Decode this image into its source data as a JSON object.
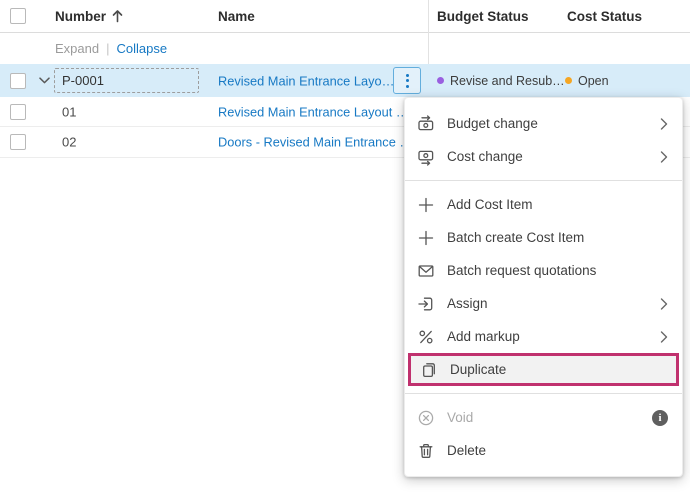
{
  "table": {
    "header": {
      "columns": {
        "number": "Number",
        "name": "Name",
        "budget_status": "Budget Status",
        "cost_status": "Cost Status"
      },
      "sort": {
        "column": "Number",
        "direction": "ascending"
      }
    },
    "toolbar": {
      "expand_label": "Expand",
      "separator": "|",
      "collapse_label": "Collapse"
    },
    "rows": [
      {
        "number": "P-0001",
        "name": "Revised Main Entrance Layo…",
        "budget_status": "Revise and Resub…",
        "cost_status": "Open",
        "selected": true,
        "expanded": true
      },
      {
        "number": "01",
        "name": "Revised Main Entrance Layout …"
      },
      {
        "number": "02",
        "name": "Doors - Revised Main Entrance …"
      }
    ]
  },
  "context_menu": {
    "groups": [
      {
        "items": [
          {
            "label": "Budget change",
            "icon": "budget-change-icon",
            "has_submenu": true
          },
          {
            "label": "Cost change",
            "icon": "cost-change-icon",
            "has_submenu": true
          }
        ]
      },
      {
        "items": [
          {
            "label": "Add Cost Item",
            "icon": "plus-icon"
          },
          {
            "label": "Batch create Cost Item",
            "icon": "plus-icon"
          },
          {
            "label": "Batch request quotations",
            "icon": "envelope-icon"
          },
          {
            "label": "Assign",
            "icon": "assign-icon",
            "has_submenu": true
          },
          {
            "label": "Add markup",
            "icon": "percent-icon",
            "has_submenu": true
          },
          {
            "label": "Duplicate",
            "icon": "duplicate-icon",
            "highlighted": true
          }
        ]
      },
      {
        "items": [
          {
            "label": "Void",
            "icon": "void-icon",
            "disabled": true,
            "has_info": true
          },
          {
            "label": "Delete",
            "icon": "trash-icon"
          }
        ]
      }
    ]
  },
  "colors": {
    "link": "#1779c4",
    "selected_row_background": "#d7ecf9",
    "budget_status_dot": "#9a5fe0",
    "cost_status_dot": "#f5a623",
    "highlight_annotation_border": "#c0316e",
    "kebab_button_border": "#63aedd",
    "disabled_text": "#a9a9a9"
  }
}
